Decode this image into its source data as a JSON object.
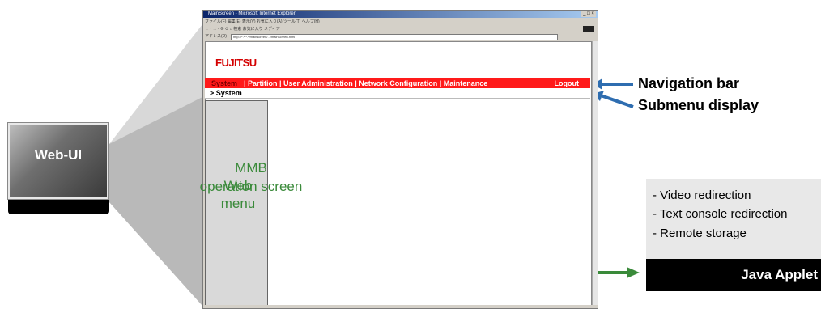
{
  "web_ui": {
    "label": "Web-UI"
  },
  "browser": {
    "title": "MainScreen - Microsoft Internet Explorer",
    "window_controls": "_ □ ×",
    "menu_text": "ファイル(F)  編集(E)  表示(V)  お気に入り(A)  ツール(T)  ヘルプ(H)",
    "toolbar_text": "← · → · ⊗  ⟳  ⌂   検索   お気に入り   メディア",
    "address_label": "アドレス(D)",
    "address_value": "http://*.*.*.*/mainscreen/.../mainscreen.html",
    "status_text": ""
  },
  "page": {
    "logo": "FUJITSU",
    "nav": {
      "system": "System",
      "rest": "| Partition | User Administration | Network Configuration | Maintenance",
      "logout": "Logout"
    },
    "submenu": "> System",
    "web_menu": [
      "Web",
      "menu"
    ],
    "mmb": [
      "MMB",
      "operation screen"
    ]
  },
  "callouts": {
    "navigation_bar": "Navigation bar",
    "submenu_display": "Submenu display"
  },
  "applet": {
    "features": [
      "- Video redirection",
      "- Text console redirection",
      "- Remote storage"
    ],
    "label": "Java Applet"
  },
  "colors": {
    "nav_red": "#ff1a1a",
    "logo_red": "#d40000",
    "screen_text_green": "#3a8a3a",
    "arrow_blue": "#2e6db0",
    "arrow_green": "#3a8a3a"
  }
}
